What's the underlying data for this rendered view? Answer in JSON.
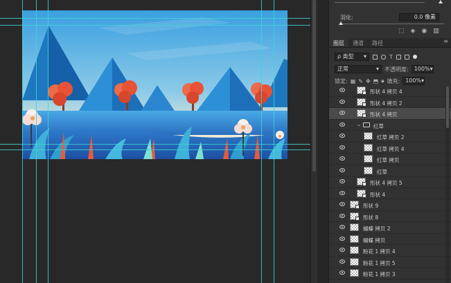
{
  "properties": {
    "feather_label": "羽化:",
    "feather_value": "0.0 像素",
    "mask_icons": [
      "selection-icon",
      "mask-icon",
      "eye-icon",
      "trash-icon"
    ]
  },
  "tabs": [
    {
      "label": "图层",
      "active": true
    },
    {
      "label": "通道",
      "active": false
    },
    {
      "label": "路径",
      "active": false
    }
  ],
  "filter": {
    "kind_label": "类型",
    "search_glyph": "ρ"
  },
  "blend": {
    "mode": "正常",
    "opacity_label": "不透明度:",
    "opacity_value": "100%"
  },
  "lock": {
    "lock_label": "锁定:",
    "fill_label": "填充:",
    "fill_value": "100%"
  },
  "layers": [
    {
      "name": "形状 4 拷贝 4",
      "indent": 1,
      "selected": false,
      "folder": false,
      "shape": true
    },
    {
      "name": "形状 4 拷贝 2",
      "indent": 1,
      "selected": false,
      "folder": false,
      "shape": true
    },
    {
      "name": "形状 4 拷贝",
      "indent": 1,
      "selected": true,
      "folder": false,
      "shape": true
    },
    {
      "name": "红草",
      "indent": 1,
      "selected": false,
      "folder": true,
      "shape": false
    },
    {
      "name": "红草 拷贝 2",
      "indent": 2,
      "selected": false,
      "folder": false,
      "shape": false
    },
    {
      "name": "红草 拷贝 4",
      "indent": 2,
      "selected": false,
      "folder": false,
      "shape": false
    },
    {
      "name": "红草 拷贝",
      "indent": 2,
      "selected": false,
      "folder": false,
      "shape": false
    },
    {
      "name": "红草",
      "indent": 2,
      "selected": false,
      "folder": false,
      "shape": false
    },
    {
      "name": "形状 4 拷贝 5",
      "indent": 1,
      "selected": false,
      "folder": false,
      "shape": true
    },
    {
      "name": "形状 4",
      "indent": 1,
      "selected": false,
      "folder": false,
      "shape": true
    },
    {
      "name": "形状 9",
      "indent": 0,
      "selected": false,
      "folder": false,
      "shape": true
    },
    {
      "name": "形状 8",
      "indent": 0,
      "selected": false,
      "folder": false,
      "shape": true
    },
    {
      "name": "蝴蝶 拷贝 2",
      "indent": 0,
      "selected": false,
      "folder": false,
      "shape": false
    },
    {
      "name": "蝴蝶 拷贝",
      "indent": 0,
      "selected": false,
      "folder": false,
      "shape": false
    },
    {
      "name": "粉花 1 拷贝 4",
      "indent": 0,
      "selected": false,
      "folder": false,
      "shape": false
    },
    {
      "name": "粉花 1 拷贝 5",
      "indent": 0,
      "selected": false,
      "folder": false,
      "shape": false
    },
    {
      "name": "粉花 1 拷贝 3",
      "indent": 0,
      "selected": false,
      "folder": false,
      "shape": false
    }
  ],
  "colors": {
    "sky_top": "#3aa0e0",
    "sky_bottom": "#f5e9c8",
    "mountain": "#1f7fc4",
    "tree": "#e8553a",
    "guide": "#3fd4d4"
  }
}
